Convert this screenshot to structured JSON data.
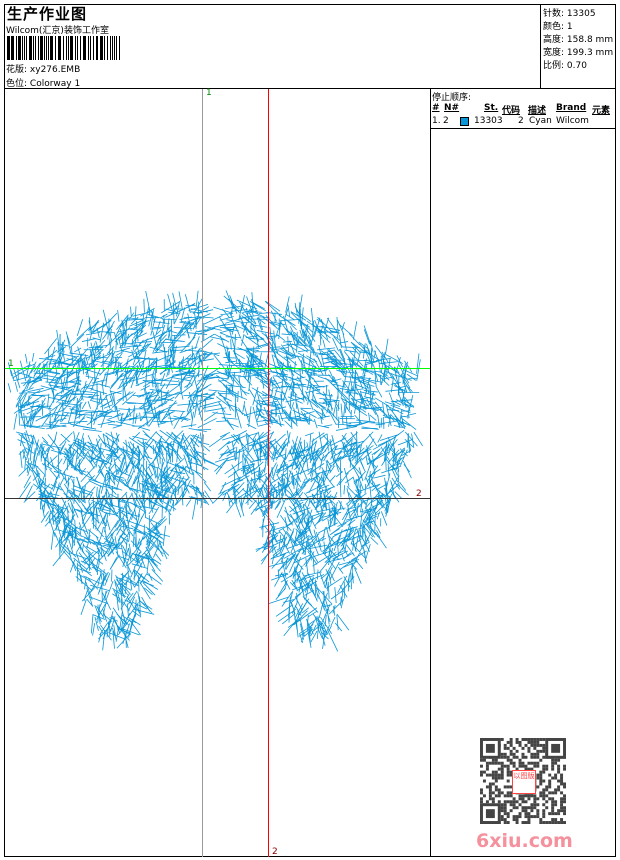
{
  "header": {
    "title": "生产作业图",
    "company": "Wilcom(汇京)装饰工作室",
    "design_label": "花版:",
    "design_value": "xy276.EMB",
    "colorway_label": "色位:",
    "colorway_value": "Colorway 1"
  },
  "stats": [
    {
      "label": "针数:",
      "value": "13305"
    },
    {
      "label": "颜色:",
      "value": "1"
    },
    {
      "label": "高度:",
      "value": "158.8 mm"
    },
    {
      "label": "宽度:",
      "value": "199.3 mm"
    },
    {
      "label": "比例:",
      "value": "0.70"
    }
  ],
  "stop_sequence": {
    "title": "停止顺序:",
    "columns": [
      "#",
      "N#",
      "St.",
      "代码",
      "描述",
      "Brand",
      "元素"
    ],
    "rows": [
      {
        "index": "1.",
        "needle": "2",
        "color": "#0a96d6",
        "stitches": "13303",
        "code": "2",
        "description": "Cyan",
        "brand": "Wilcom",
        "element": ""
      }
    ]
  },
  "guides": {
    "v1": "1",
    "h1": "1",
    "h2": "2",
    "v2": "2"
  },
  "colors": {
    "thread": "#0a96d6",
    "guide_red": "#ff0000",
    "guide_green": "#00ff00"
  },
  "watermark": {
    "text": "6xiu.com",
    "stamp": "以图版"
  }
}
